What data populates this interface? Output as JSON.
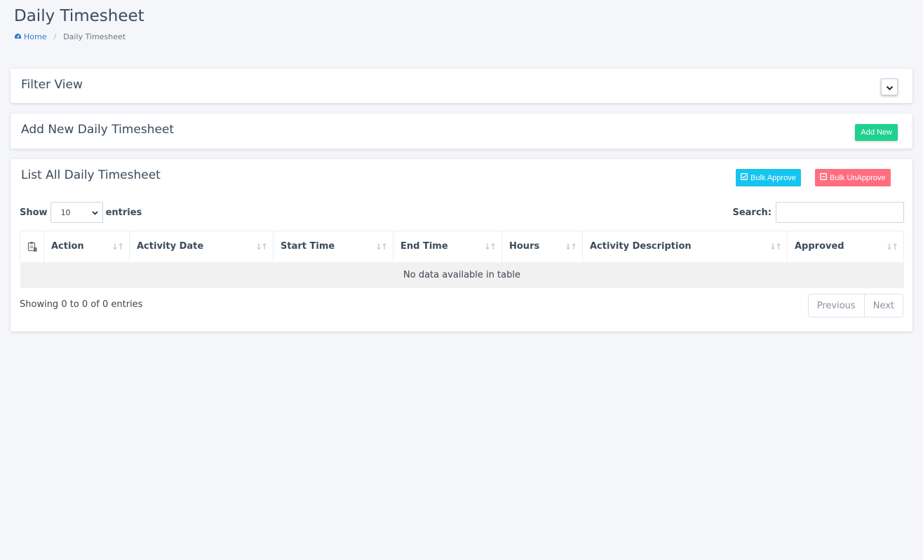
{
  "page": {
    "title": "Daily Timesheet",
    "breadcrumb": {
      "home_icon": "dashboard-icon",
      "home": "Home",
      "current": "Daily Timesheet"
    }
  },
  "filter": {
    "title": "Filter View",
    "toggle_icon": "chevron-down-icon"
  },
  "add": {
    "title": "Add New Daily Timesheet",
    "button": "Add New"
  },
  "list": {
    "title": "List All Daily Timesheet",
    "bulk_approve": "Bulk Approve",
    "bulk_unapprove": "Bulk UnApprove",
    "show_label": "Show",
    "page_length": "10",
    "entries_label": "entries",
    "search_label": "Search:",
    "search_value": "",
    "columns": [
      "Action",
      "Activity Date",
      "Start Time",
      "End Time",
      "Hours",
      "Activity Description",
      "Approved"
    ],
    "empty_message": "No data available in table",
    "info": "Showing 0 to 0 of 0 entries",
    "prev": "Previous",
    "next": "Next"
  },
  "colors": {
    "accent": "#2f7ad1",
    "add_button": "#1ed18f",
    "approve_button": "#16c4f0",
    "unapprove_button": "#ff6e80"
  }
}
